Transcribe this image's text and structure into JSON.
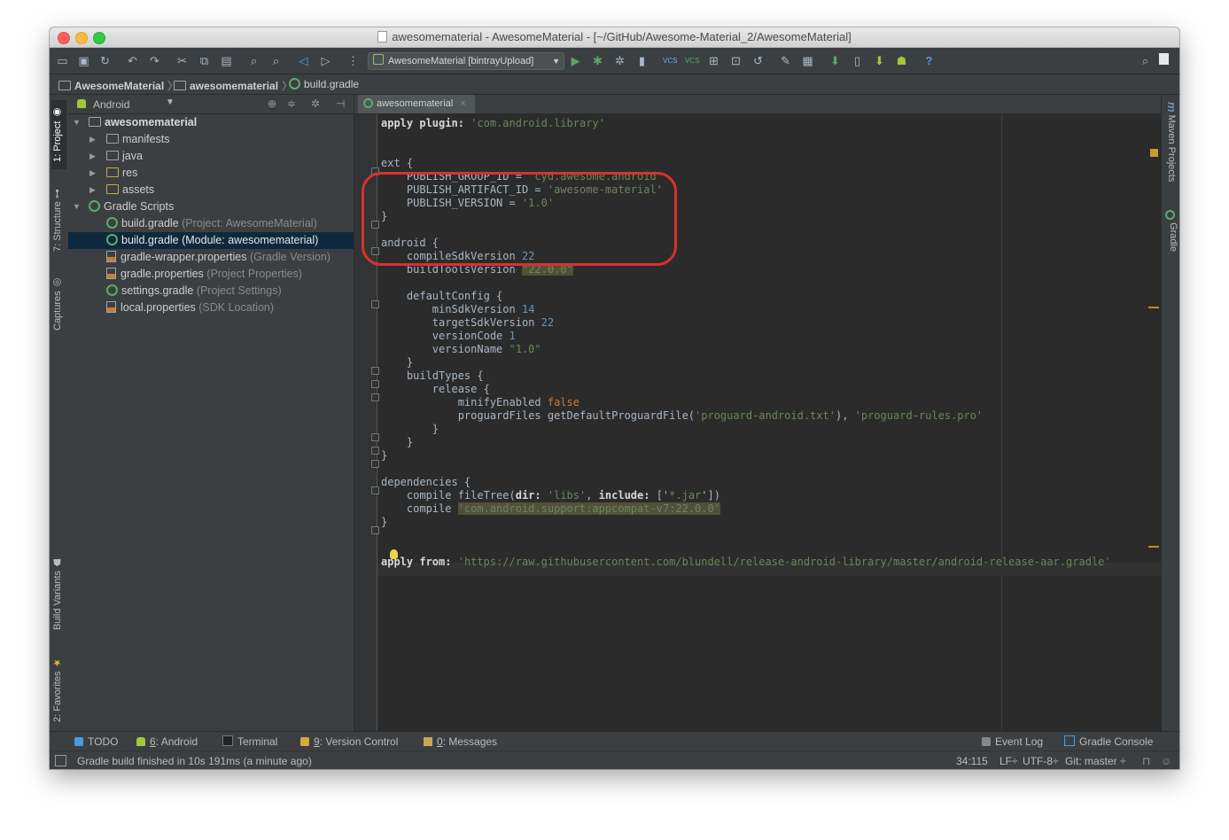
{
  "window": {
    "title": "awesomematerial - AwesomeMaterial - [~/GitHub/Awesome-Material_2/AwesomeMaterial]"
  },
  "toolbar": {
    "run_configuration": "AwesomeMaterial [bintrayUpload]",
    "vcs_label_1": "VCS",
    "vcs_label_2": "VCS",
    "help": "?"
  },
  "breadcrumb": {
    "items": [
      "AwesomeMaterial",
      "awesomematerial",
      "build.gradle"
    ]
  },
  "left_strip": {
    "tabs": [
      "1: Project",
      "7: Structure",
      "Captures",
      "Build Variants",
      "2: Favorites"
    ]
  },
  "right_strip": {
    "tabs": [
      "Maven Projects",
      "Gradle"
    ],
    "m_glyph": "m"
  },
  "project_panel": {
    "view_mode": "Android",
    "tree": [
      {
        "name": "awesomematerial",
        "detail": ""
      },
      {
        "name": "manifests",
        "detail": ""
      },
      {
        "name": "java",
        "detail": ""
      },
      {
        "name": "res",
        "detail": ""
      },
      {
        "name": "assets",
        "detail": ""
      },
      {
        "name": "Gradle Scripts",
        "detail": ""
      },
      {
        "name": "build.gradle",
        "detail": "(Project: AwesomeMaterial)"
      },
      {
        "name": "build.gradle (Module: awesomematerial)",
        "detail": ""
      },
      {
        "name": "gradle-wrapper.properties",
        "detail": "(Gradle Version)"
      },
      {
        "name": "gradle.properties",
        "detail": "(Project Properties)"
      },
      {
        "name": "settings.gradle",
        "detail": "(Project Settings)"
      },
      {
        "name": "local.properties",
        "detail": "(SDK Location)"
      }
    ]
  },
  "editor": {
    "tab_label": "awesomematerial",
    "tab_close": "×",
    "code": {
      "l1": {
        "kw": "apply plugin:",
        "s": "'com.android.library'"
      },
      "l3": "ext {",
      "l4": {
        "k": "PUBLISH_GROUP_ID = ",
        "s": "'cyd.awesome.android'"
      },
      "l5": {
        "k": "PUBLISH_ARTIFACT_ID = ",
        "s": "'awesome-material'"
      },
      "l6": {
        "k": "PUBLISH_VERSION = ",
        "s": "'1.0'"
      },
      "l7": "}",
      "l8": "android {",
      "l9": {
        "k": "compileSdkVersion ",
        "n": "22"
      },
      "l10": {
        "k": "buildToolsVersion ",
        "s": "\"22.0.0\""
      },
      "l12": "defaultConfig {",
      "l13": {
        "k": "minSdkVersion ",
        "n": "14"
      },
      "l14": {
        "k": "targetSdkVersion ",
        "n": "22"
      },
      "l15": {
        "k": "versionCode ",
        "n": "1"
      },
      "l16": {
        "k": "versionName ",
        "s": "\"1.0\""
      },
      "l17": "}",
      "l18": "buildTypes {",
      "l19": "release {",
      "l20": {
        "k": "minifyEnabled ",
        "kw": "false"
      },
      "l21": {
        "k": "proguardFiles getDefaultProguardFile(",
        "s1": "'proguard-android.txt'",
        "sep": "), ",
        "s2": "'proguard-rules.pro'"
      },
      "l22": "}",
      "l23": "}",
      "l24": "}",
      "l26": "dependencies {",
      "l27": {
        "k": "compile fileTree(",
        "b1": "dir:",
        "s1": " 'libs'",
        "sep": ", ",
        "b2": "include:",
        "sep2": " ['",
        "s2": "*.jar",
        "end": "'])"
      },
      "l28": {
        "k": "compile ",
        "s": "'com.android.support:appcompat-v7:22.0.0'"
      },
      "l29": "}",
      "l32": {
        "kw": "apply from:",
        "s": "'https://raw.githubusercontent.com/blundell/release-android-library/master/android-release-aar.gradle'"
      }
    }
  },
  "tool_windows": {
    "todo": "TODO",
    "android_num": "6",
    "android": ": Android",
    "terminal": "Terminal",
    "vc_num": "9",
    "vc": ": Version Control",
    "msg_num": "0",
    "msg": ": Messages",
    "event_log": "Event Log",
    "gradle_console": "Gradle Console"
  },
  "status": {
    "message": "Gradle build finished in 10s 191ms (a minute ago)",
    "position": "34:115",
    "line_sep": "LF÷",
    "encoding": "UTF-8÷",
    "git": "Git: master ÷"
  },
  "colors": {
    "background": "#2b2b2b",
    "keyword": "#cc7832",
    "string": "#6a8759",
    "number": "#6897bb",
    "annotation_box": "#d8322c"
  }
}
